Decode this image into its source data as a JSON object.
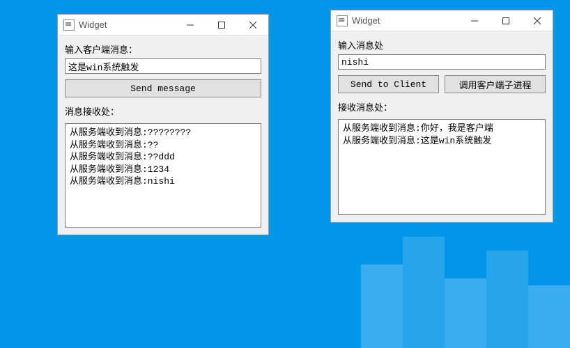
{
  "left": {
    "title": "Widget",
    "input_label": "输入客户端消息：",
    "input_value": "这是win系统触发",
    "send_label": "Send message",
    "recv_label": "消息接收处：",
    "lines": [
      "从服务端收到消息:????????",
      "从服务端收到消息:??",
      "从服务端收到消息:??ddd",
      "从服务端收到消息:1234",
      "从服务端收到消息:nishi"
    ]
  },
  "right": {
    "title": "Widget",
    "input_label": "输入消息处",
    "input_value": "nishi",
    "send_label": "Send to Client",
    "call_label": "调用客户端子进程",
    "recv_label": "接收消息处：",
    "lines": [
      "从服务端收到消息:你好，我是客户端",
      "从服务端收到消息:这是win系统触发"
    ]
  }
}
